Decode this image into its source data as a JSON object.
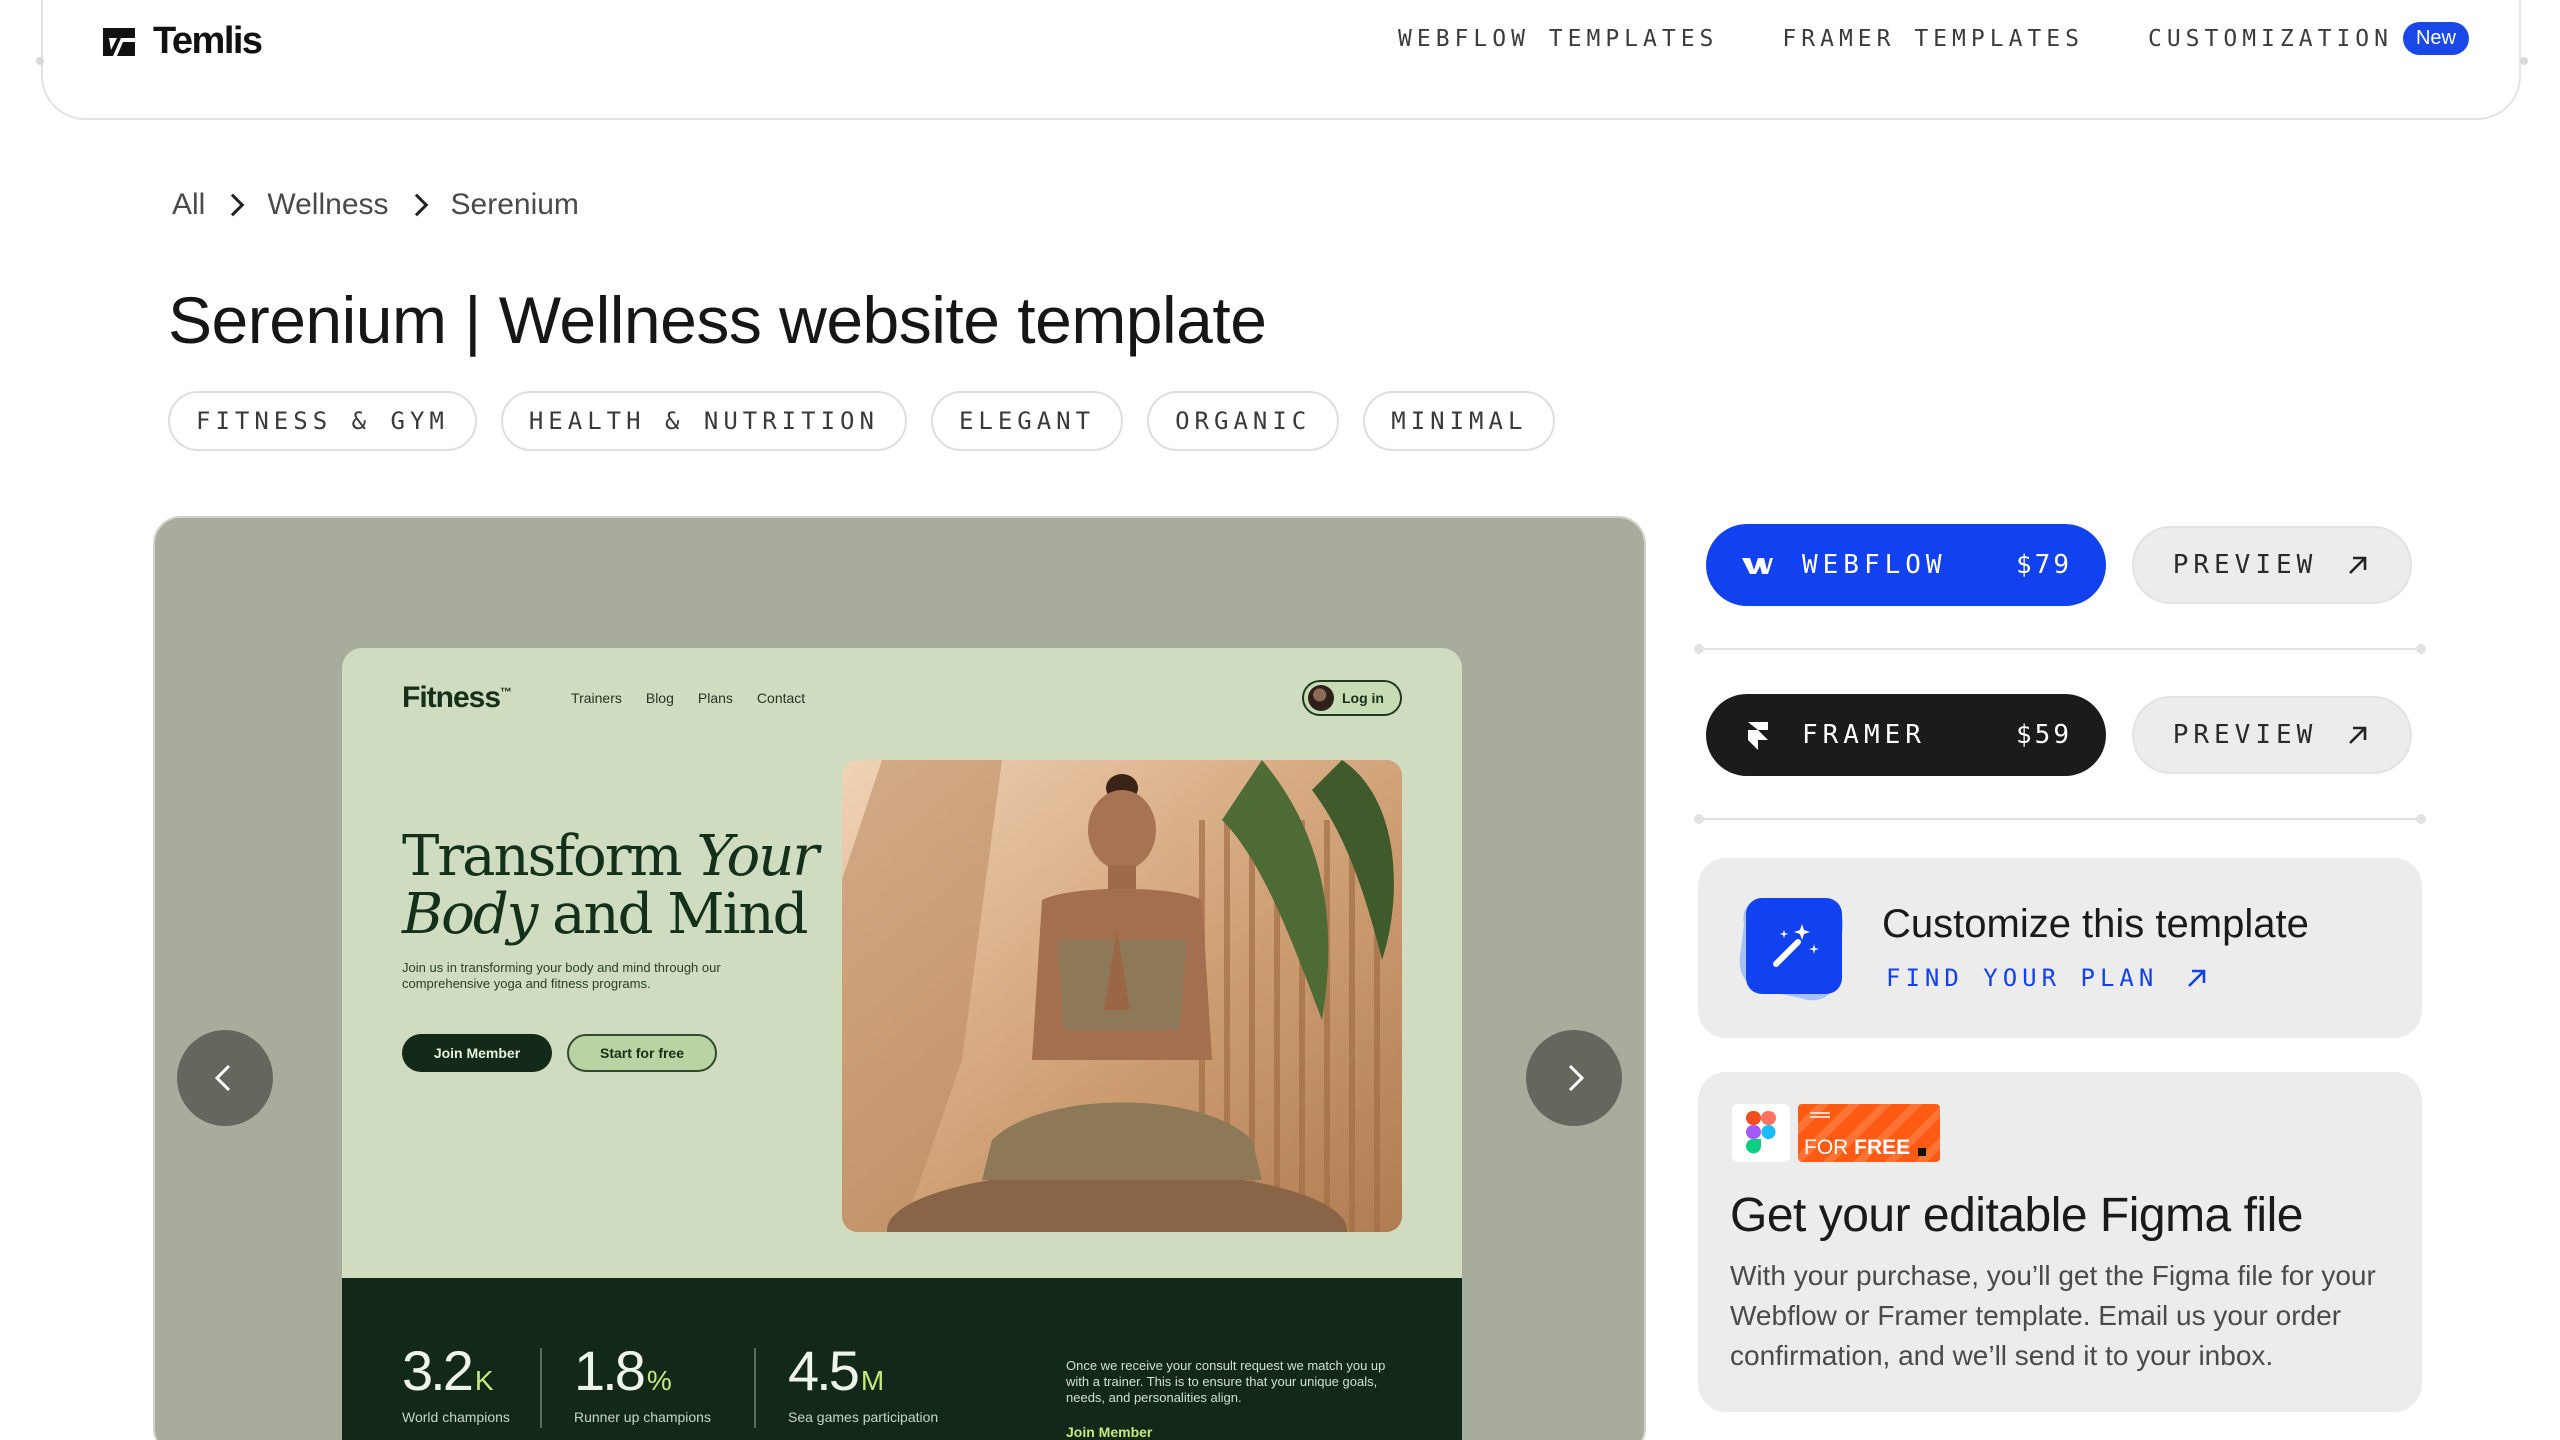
{
  "brand": {
    "name": "Temlis",
    "logo_icon": "temlis-logo-icon"
  },
  "nav": {
    "items": [
      {
        "label": "WEBFLOW TEMPLATES"
      },
      {
        "label": "FRAMER TEMPLATES"
      },
      {
        "label": "CUSTOMIZATION",
        "badge": "New"
      }
    ]
  },
  "breadcrumb": {
    "items": [
      "All",
      "Wellness",
      "Serenium"
    ],
    "separator_icon": "chevron-right-icon"
  },
  "page": {
    "title": "Serenium | Wellness website template"
  },
  "tags": [
    "FITNESS & GYM",
    "HEALTH & NUTRITION",
    "ELEGANT",
    "ORGANIC",
    "MINIMAL"
  ],
  "preview": {
    "prev_icon": "chevron-left-icon",
    "next_icon": "chevron-right-icon",
    "mock": {
      "brand": "Fitness",
      "brand_mark": "™",
      "links": [
        "Trainers",
        "Blog",
        "Plans",
        "Contact"
      ],
      "login": "Log in",
      "headline_line1_a": "Transform ",
      "headline_line1_b": "Your",
      "headline_line2_a": "Body",
      "headline_line2_b": " and Mind",
      "subtitle": "Join us in transforming your body and mind through our comprehensive yoga and fitness programs.",
      "primary_button": "Join Member",
      "secondary_button": "Start for free",
      "stats": [
        {
          "value": "3.2",
          "unit": "K",
          "label": "World champions"
        },
        {
          "value": "1.8",
          "unit": "%",
          "label": "Runner up champions"
        },
        {
          "value": "4.5",
          "unit": "M",
          "label": "Sea games participation"
        }
      ],
      "note": "Once we receive your consult request we match you up with a trainer. This is to ensure that your unique goals, needs, and personalities align.",
      "note_link": "Join Member"
    }
  },
  "purchase": {
    "webflow": {
      "label": "WEBFLOW",
      "price": "$79",
      "icon": "webflow-logo-icon",
      "color": "#1242f0"
    },
    "framer": {
      "label": "FRAMER",
      "price": "$59",
      "icon": "framer-logo-icon",
      "color": "#1b1b1b"
    },
    "preview_label": "PREVIEW",
    "preview_icon": "arrow-up-right-icon"
  },
  "customize": {
    "title": "Customize this template",
    "link": "FIND YOUR PLAN",
    "icon": "magic-wand-icon"
  },
  "figma": {
    "free_tag_a": "FOR ",
    "free_tag_b": "FREE",
    "title": "Get your editable Figma file",
    "body": "With your purchase, you’ll get the Figma file for your Webflow or Framer template. Email us your order confirmation, and we’ll send it to your inbox.",
    "icon": "figma-logo-icon"
  }
}
